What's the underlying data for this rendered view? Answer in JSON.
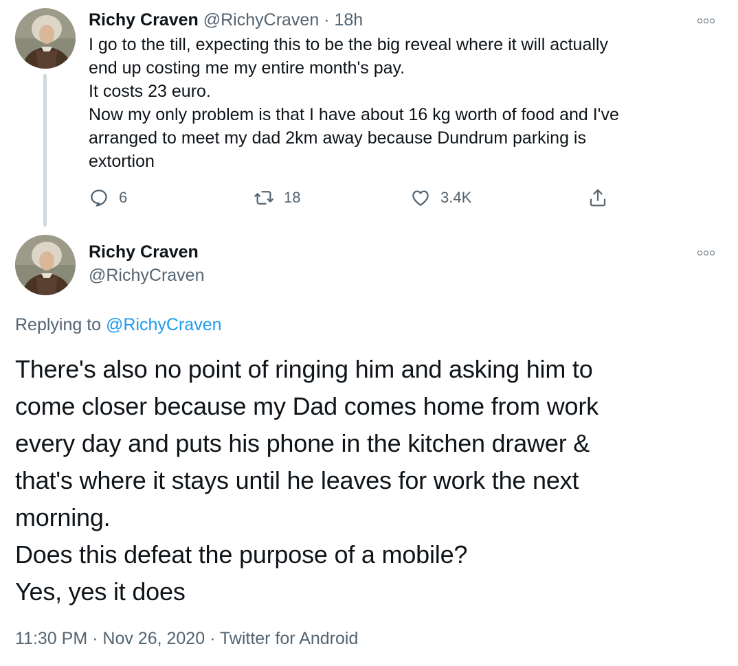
{
  "parent_tweet": {
    "display_name": "Richy Craven",
    "handle": "@RichyCraven",
    "separator": "·",
    "time": "18h",
    "lines": [
      "I go to the till, expecting this to be the big reveal where it will actually",
      "end up costing me my entire month's pay.",
      "It costs 23 euro.",
      "Now my only problem is that I have about 16 kg worth of food and I've",
      "arranged to meet my dad 2km away because Dundrum parking is",
      "extortion"
    ],
    "actions": {
      "reply_count": "6",
      "retweet_count": "18",
      "like_count": "3.4K"
    },
    "icons": [
      "reply-icon",
      "retweet-icon",
      "like-icon",
      "share-icon",
      "more-icon"
    ]
  },
  "main_tweet": {
    "display_name": "Richy Craven",
    "handle": "@RichyCraven",
    "replying_prefix": "Replying to",
    "replying_to": "@RichyCraven",
    "lines": [
      "There's also no point of ringing him and asking him to",
      "come closer because my Dad comes home from work",
      "every day and puts his phone in the kitchen drawer &",
      "that's where it stays until he leaves for work the next",
      "morning.",
      "Does this defeat the purpose of a mobile?",
      "Yes, yes it does"
    ],
    "meta": {
      "time": "11:30 PM",
      "separator": "·",
      "date": "Nov 26, 2020",
      "source": "Twitter for Android"
    }
  },
  "colors": {
    "text": "#0f1419",
    "muted": "#536471",
    "link": "#1d9bf0",
    "thread_line": "#cfd9de"
  }
}
